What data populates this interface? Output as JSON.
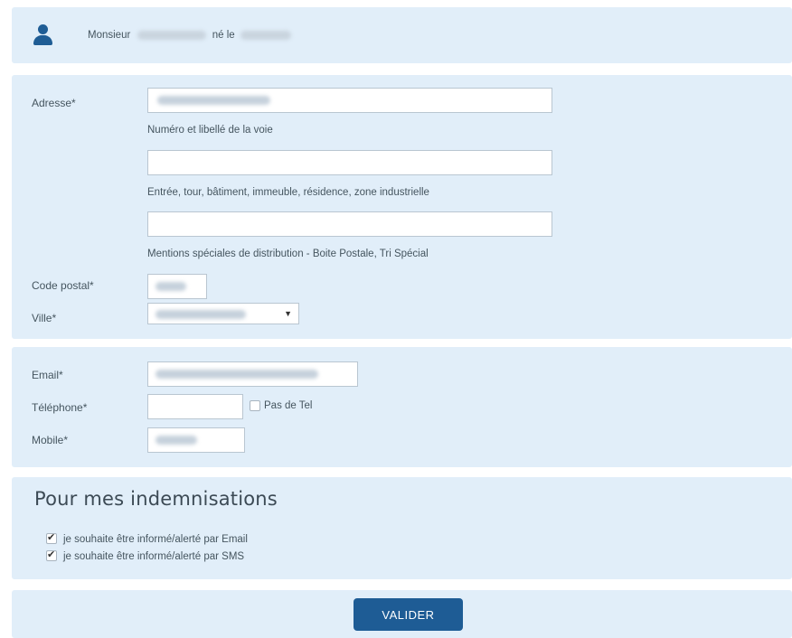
{
  "person": {
    "civility": "Monsieur",
    "born_label": "né le"
  },
  "address": {
    "adresse_label": "Adresse*",
    "line1_help": "Numéro et libellé de la voie",
    "line2_help": "Entrée, tour, bâtiment, immeuble, résidence, zone industrielle",
    "line3_help": "Mentions spéciales de distribution - Boite Postale, Tri Spécial",
    "postal_label": "Code postal*",
    "city_label": "Ville*",
    "city_arrow": "▼"
  },
  "contact": {
    "email_label": "Email*",
    "phone_label": "Téléphone*",
    "no_phone_label": "Pas de Tel",
    "mobile_label": "Mobile*"
  },
  "indemnisation": {
    "title": "Pour mes indemnisations",
    "opt_email": "je souhaite être informé/alerté par Email",
    "opt_sms": "je souhaite être informé/alerté par SMS",
    "opt_email_checked": true,
    "opt_sms_checked": true
  },
  "submit": {
    "label": "VALIDER"
  },
  "colors": {
    "panel_bg": "#e1eef9",
    "accent": "#1e5c95"
  }
}
